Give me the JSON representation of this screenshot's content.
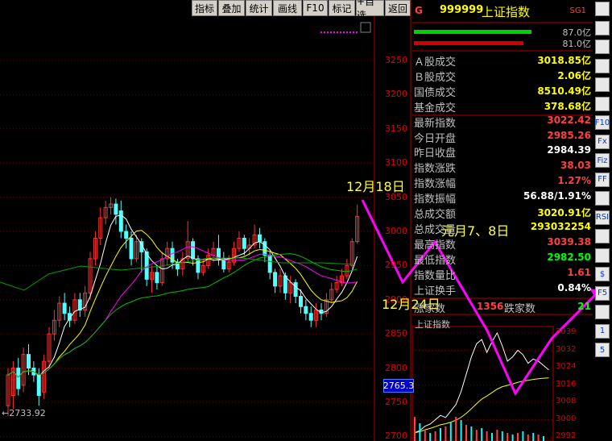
{
  "toolbar": {
    "buttons": [
      "指标",
      "叠加",
      "统计",
      "画线",
      "F10",
      "标记",
      "+自选",
      "返回"
    ]
  },
  "chart": {
    "price_labels": [
      "3250",
      "3200",
      "3150",
      "3100",
      "3050",
      "3000",
      "2950",
      "2900",
      "2850",
      "2800",
      "2750",
      "2700"
    ],
    "current_marker": "2765.3",
    "low_marker": "←2733.92",
    "annotation_1": "12月18日",
    "annotation_2": "元月7、8日",
    "annotation_3": "12月24日"
  },
  "info": {
    "header_code": "999999",
    "header_name": "上证指数",
    "header_tag": "SG1",
    "header_g": "G",
    "bar1_value": "87.0亿",
    "bar2_value": "81.0亿",
    "rows": [
      {
        "label": "Ａ股成交",
        "value": "3018.85亿",
        "color": "#ffff00"
      },
      {
        "label": "Ｂ股成交",
        "value": "2.06亿",
        "color": "#ffff00"
      },
      {
        "label": "国债成交",
        "value": "8510.49亿",
        "color": "#ffff00"
      },
      {
        "label": "基金成交",
        "value": "378.68亿",
        "color": "#ffff00"
      },
      {
        "label": "最新指数",
        "value": "3022.42",
        "color": "#ff4040"
      },
      {
        "label": "今日开盘",
        "value": "2985.26",
        "color": "#ff4040"
      },
      {
        "label": "昨日收盘",
        "value": "2984.39",
        "color": "#ffffff"
      },
      {
        "label": "指数涨跌",
        "value": "38.03",
        "color": "#ff4040"
      },
      {
        "label": "指数涨幅",
        "value": "1.27%",
        "color": "#ff4040"
      },
      {
        "label": "指数振幅",
        "value": "56.88/1.91%",
        "color": "#ffffff"
      },
      {
        "label": "总成交额",
        "value": "3020.91亿",
        "color": "#ffff00"
      },
      {
        "label": "总成交量",
        "value": "293032254",
        "color": "#ffff00"
      },
      {
        "label": "最高指数",
        "value": "3039.38",
        "color": "#ff4040"
      },
      {
        "label": "最低指数",
        "value": "2982.50",
        "color": "#00ff00"
      },
      {
        "label": "指数量比",
        "value": "1.61",
        "color": "#ff4040"
      },
      {
        "label": "上证换手",
        "value": "0.84%",
        "color": "#ffffff"
      }
    ],
    "updown": {
      "up_label": "涨家数",
      "up_count": "1356",
      "down_label": "跌家数",
      "down_count": "21"
    },
    "mini_title": "上证指数",
    "mini_ticks": [
      "3039",
      "3032",
      "3024",
      "3016",
      "3008",
      "3000",
      "2992"
    ]
  },
  "side": {
    "icons": [
      "up-arrow-icon",
      "down-arrow-icon",
      "chart-icon",
      "table-icon",
      "analysis-icon",
      "candle-icon",
      "f10-icon",
      "fx-icon",
      "fiz-icon",
      "ff-icon",
      "bars-icon",
      "rsi-icon",
      "move-icon",
      "pencil-icon",
      "money-icon",
      "f5-icon",
      "globe-icon",
      "one-icon",
      "five-icon"
    ],
    "labels": [
      "",
      "",
      "",
      "",
      "",
      "",
      "F10",
      "Fx",
      "Fiz",
      "FF",
      "",
      "RSI",
      "",
      "",
      "$",
      "F5",
      "",
      "1",
      "5"
    ]
  },
  "colors": {
    "up": "#ff3232",
    "down": "#54ffff",
    "annotation": "#ff00ff",
    "accent": "#ffff00"
  }
}
